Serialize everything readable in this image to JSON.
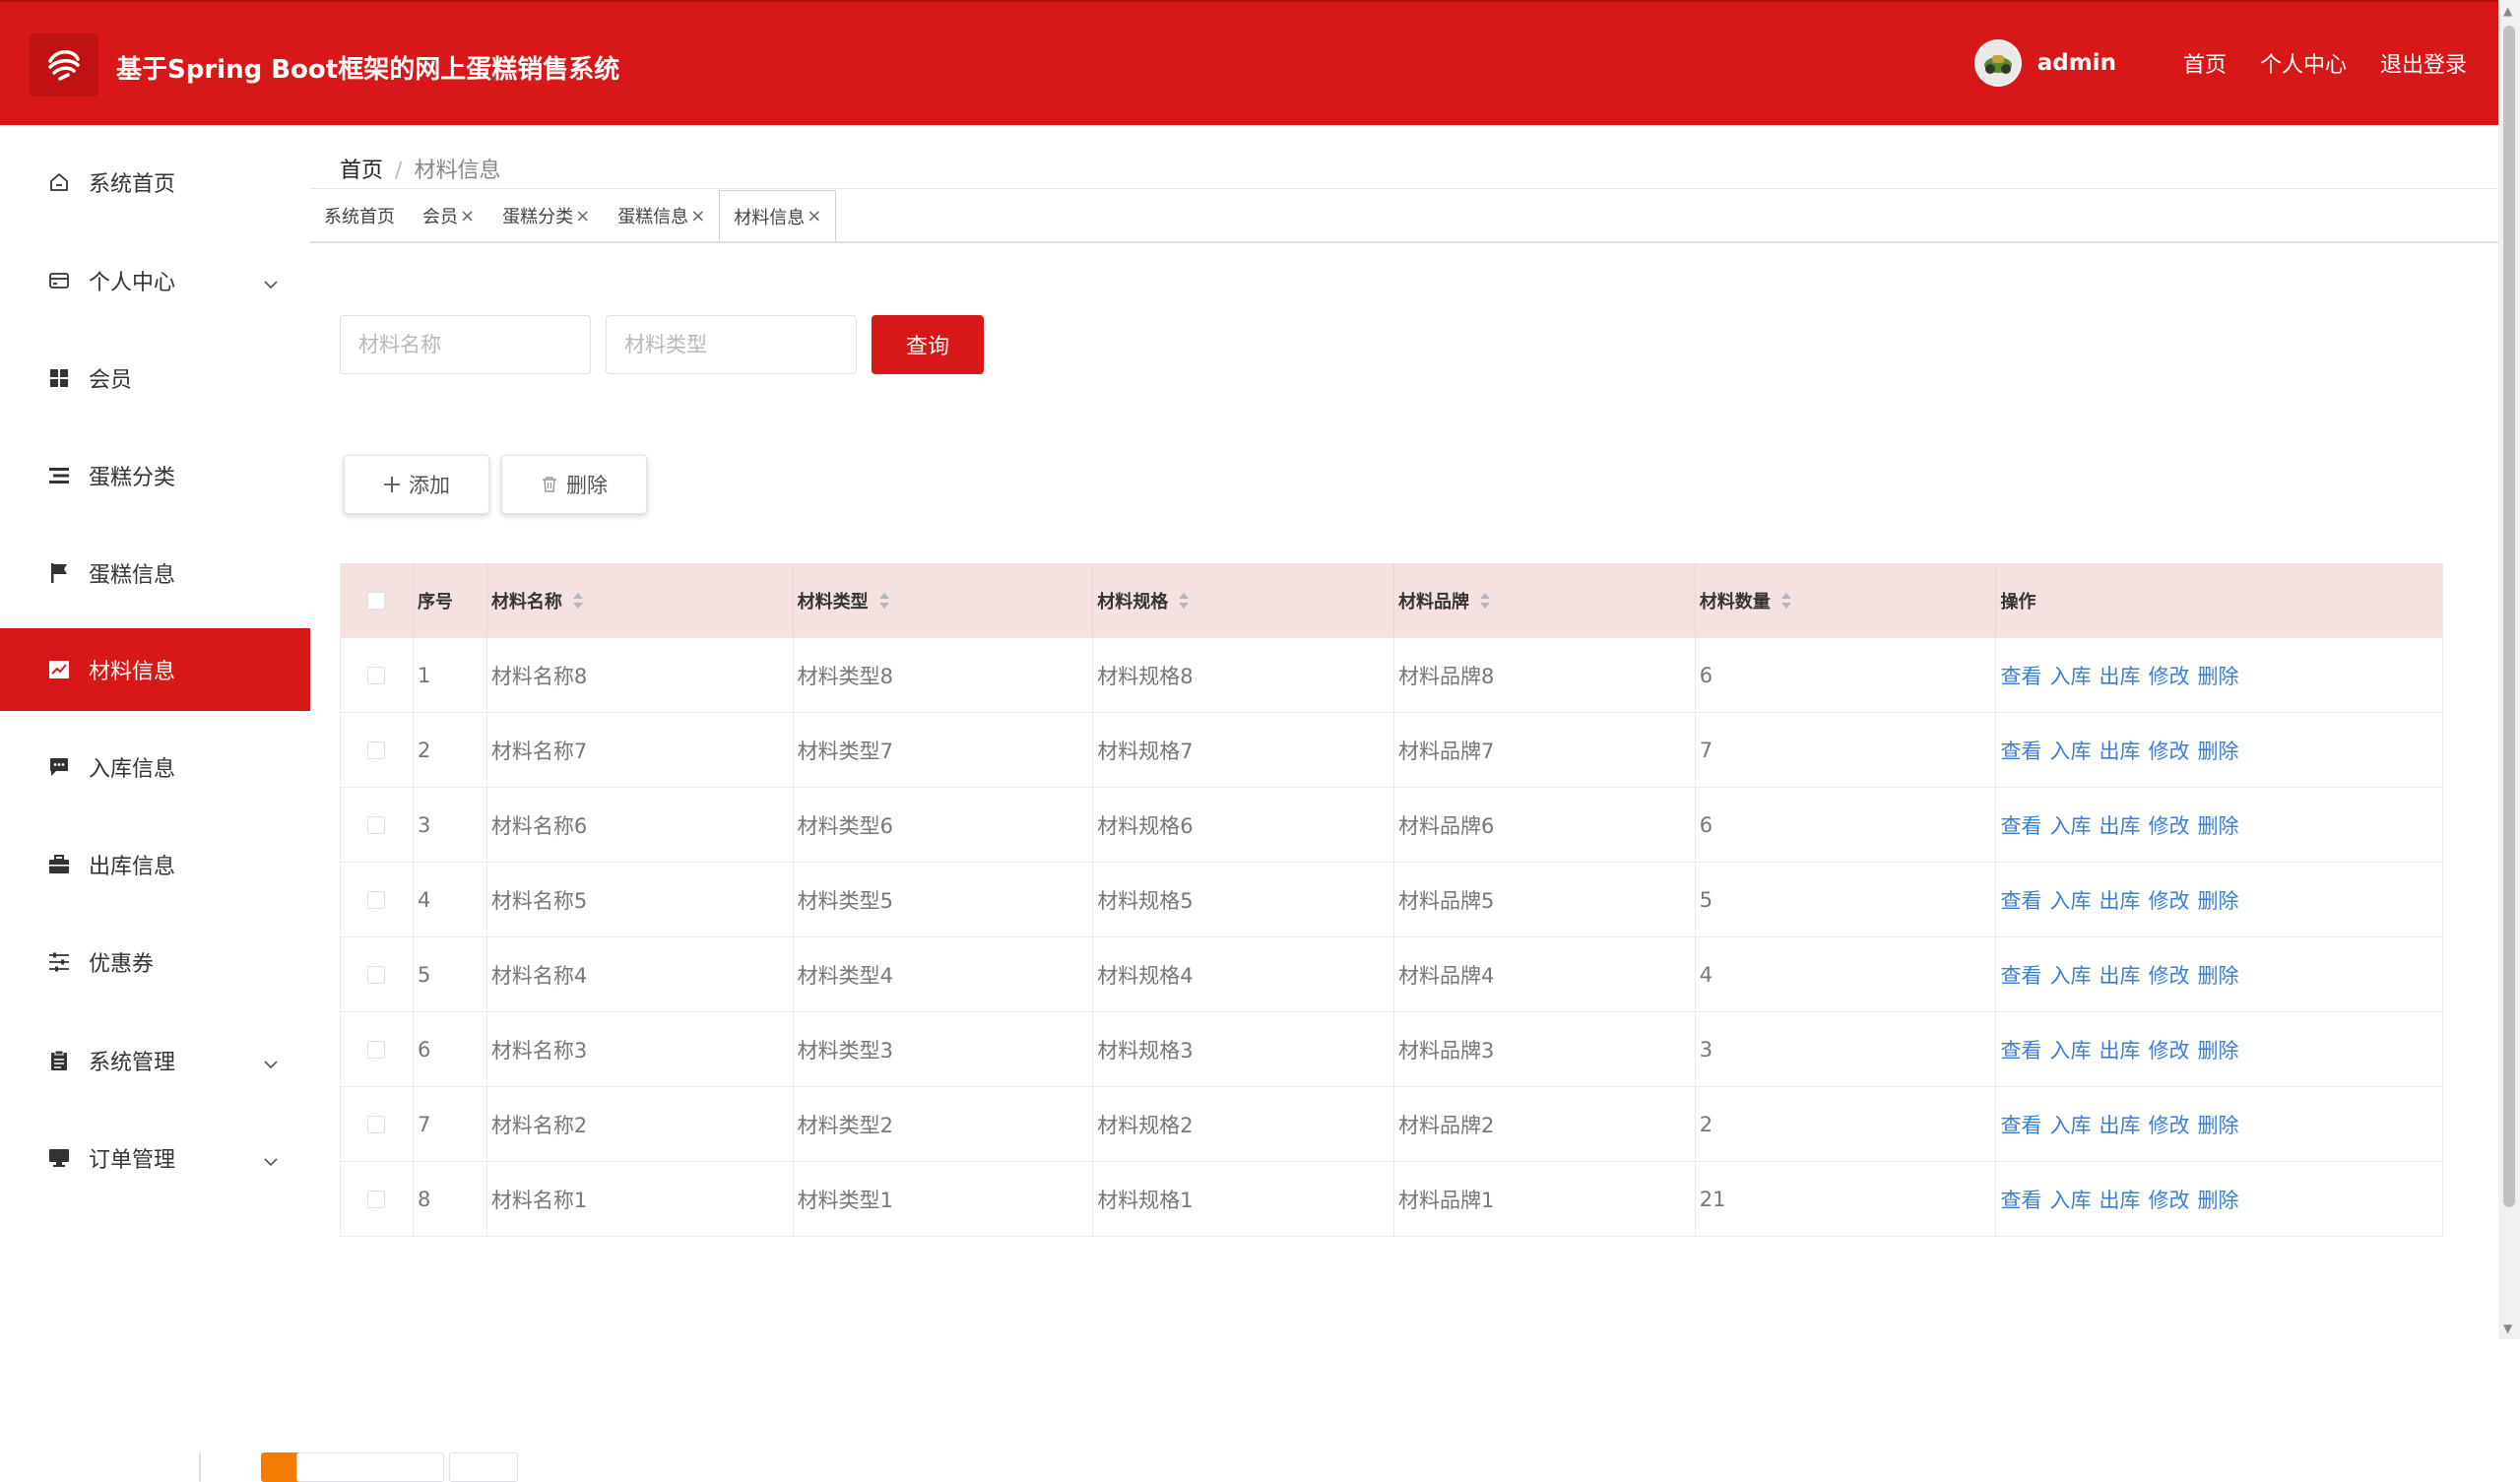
{
  "header": {
    "title": "基于Spring Boot框架的网上蛋糕销售系统",
    "username": "admin",
    "links": [
      "首页",
      "个人中心",
      "退出登录"
    ]
  },
  "sidebar": {
    "items": [
      {
        "label": "系统首页",
        "icon": "home-icon"
      },
      {
        "label": "个人中心",
        "icon": "card-icon"
      },
      {
        "label": "会员",
        "icon": "grid-icon"
      },
      {
        "label": "蛋糕分类",
        "icon": "list-icon"
      },
      {
        "label": "蛋糕信息",
        "icon": "flag-icon"
      },
      {
        "label": "材料信息",
        "icon": "chart-icon"
      },
      {
        "label": "入库信息",
        "icon": "message-icon"
      },
      {
        "label": "出库信息",
        "icon": "briefcase-icon"
      },
      {
        "label": "优惠券",
        "icon": "sliders-icon"
      },
      {
        "label": "系统管理",
        "icon": "clipboard-icon"
      },
      {
        "label": "订单管理",
        "icon": "monitor-icon"
      }
    ],
    "active": "材料信息"
  },
  "breadcrumb": {
    "home": "首页",
    "sep": "/",
    "current": "材料信息"
  },
  "tabs": [
    "系统首页",
    "会员",
    "蛋糕分类",
    "蛋糕信息",
    "材料信息"
  ],
  "tab_close": "×",
  "search": {
    "name_placeholder": "材料名称",
    "type_placeholder": "材料类型",
    "query_label": "查询"
  },
  "actions": {
    "add_label": "添加",
    "delete_label": "删除"
  },
  "table": {
    "columns": [
      "序号",
      "材料名称",
      "材料类型",
      "材料规格",
      "材料品牌",
      "材料数量",
      "操作"
    ],
    "row_actions": [
      "查看",
      "入库",
      "出库",
      "修改",
      "删除"
    ],
    "rows": [
      {
        "no": "1",
        "name": "材料名称8",
        "type": "材料类型8",
        "spec": "材料规格8",
        "brand": "材料品牌8",
        "qty": "6"
      },
      {
        "no": "2",
        "name": "材料名称7",
        "type": "材料类型7",
        "spec": "材料规格7",
        "brand": "材料品牌7",
        "qty": "7"
      },
      {
        "no": "3",
        "name": "材料名称6",
        "type": "材料类型6",
        "spec": "材料规格6",
        "brand": "材料品牌6",
        "qty": "6"
      },
      {
        "no": "4",
        "name": "材料名称5",
        "type": "材料类型5",
        "spec": "材料规格5",
        "brand": "材料品牌5",
        "qty": "5"
      },
      {
        "no": "5",
        "name": "材料名称4",
        "type": "材料类型4",
        "spec": "材料规格4",
        "brand": "材料品牌4",
        "qty": "4"
      },
      {
        "no": "6",
        "name": "材料名称3",
        "type": "材料类型3",
        "spec": "材料规格3",
        "brand": "材料品牌3",
        "qty": "3"
      },
      {
        "no": "7",
        "name": "材料名称2",
        "type": "材料类型2",
        "spec": "材料规格2",
        "brand": "材料品牌2",
        "qty": "2"
      },
      {
        "no": "8",
        "name": "材料名称1",
        "type": "材料类型1",
        "spec": "材料规格1",
        "brand": "材料品牌1",
        "qty": "21"
      }
    ]
  },
  "colors": {
    "primary": "#d81818",
    "header_row": "#f6e1e1",
    "link": "#3a7fd5",
    "page_active": "#f57c00"
  }
}
